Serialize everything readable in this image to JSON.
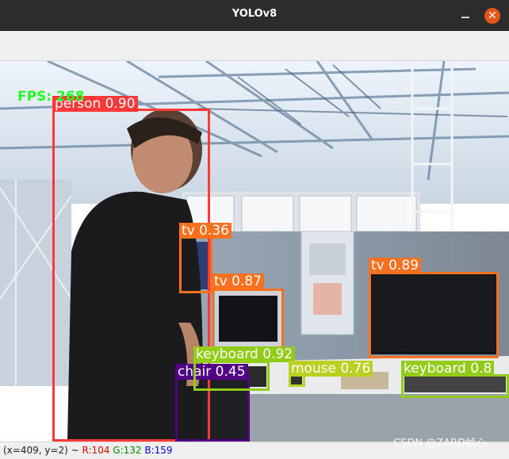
{
  "window": {
    "title": "YOLOv8",
    "close_glyph": "✕"
  },
  "overlay": {
    "fps_text": "FPS: 268"
  },
  "detections": [
    {
      "label": "person 0.90",
      "color": "#ff3838"
    },
    {
      "label": "tv 0.36",
      "color": "#ff701f"
    },
    {
      "label": "tv 0.87",
      "color": "#ff701f"
    },
    {
      "label": "tv 0.89",
      "color": "#ff701f"
    },
    {
      "label": "keyboard 0.92",
      "color": "#92cc17"
    },
    {
      "label": "chair 0.45",
      "color": "#520085"
    },
    {
      "label": "mouse 0.76",
      "color": "#bbd020"
    },
    {
      "label": "keyboard 0.8",
      "color": "#92cc17"
    }
  ],
  "status": {
    "coords": "(x=409, y=2) ~",
    "r": "R:104",
    "g": "G:132",
    "b": "B:159"
  },
  "watermark": "CSDN @ZARD帧心",
  "icons": {
    "close": "close-icon",
    "minimize": "minimize-icon"
  }
}
